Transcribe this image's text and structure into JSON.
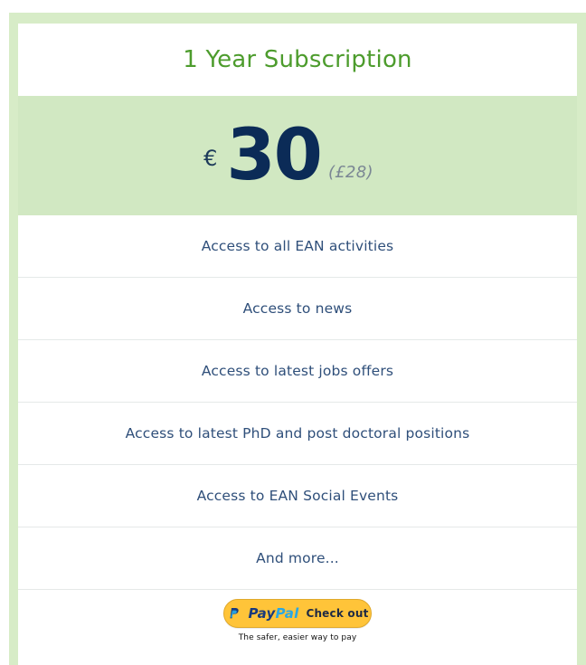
{
  "plan": {
    "title": "1 Year Subscription",
    "currency_symbol": "€",
    "amount": "30",
    "alt_price": "(£28)"
  },
  "features": [
    {
      "label": "Access to all EAN activities"
    },
    {
      "label": "Access to news"
    },
    {
      "label": "Access to latest jobs offers"
    },
    {
      "label": "Access to latest PhD and post doctoral positions"
    },
    {
      "label": "Access to EAN Social Events"
    },
    {
      "label": "And more..."
    }
  ],
  "checkout": {
    "brand_part_1": "Pay",
    "brand_part_2": "Pal",
    "cta": "Check out",
    "tagline": "The safer, easier way to pay"
  },
  "colors": {
    "brand_green": "#4d9c2d",
    "band_green": "#d1e8c2",
    "navy": "#0b2b57",
    "paypal_gold": "#ffc439"
  },
  "icons": {
    "paypal": "paypal-icon"
  }
}
